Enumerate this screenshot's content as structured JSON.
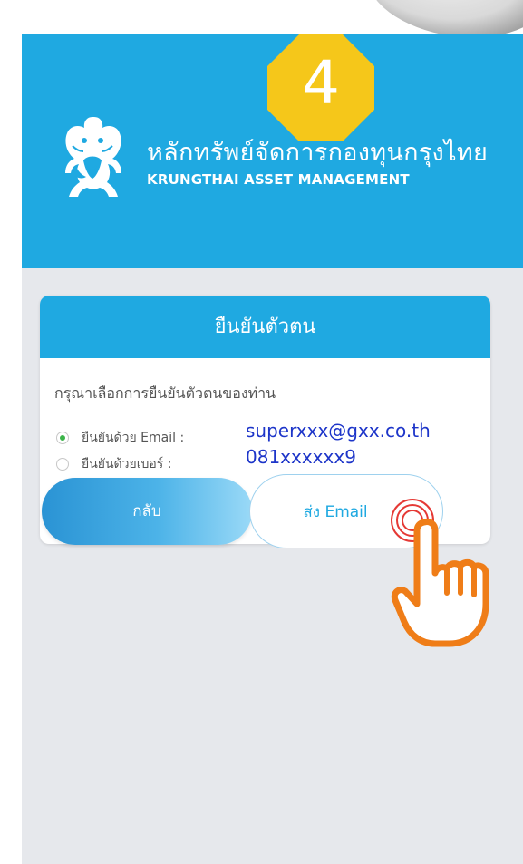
{
  "step": {
    "number": "4"
  },
  "brand": {
    "thai_name": "หลักทรัพย์จัดการกองทุนกรุงไทย",
    "english_name": "KRUNGTHAI ASSET MANAGEMENT"
  },
  "verify": {
    "title": "ยืนยันตัวตน",
    "prompt": "กรุณาเลือกการยืนยันตัวตนของท่าน",
    "options": [
      {
        "label": "ยืนยันด้วย Email :",
        "value": "superxxx@gxx.co.th",
        "selected": true
      },
      {
        "label": "ยืนยันด้วยเบอร์ :",
        "value": "081xxxxxx9",
        "selected": false
      }
    ],
    "buttons": {
      "back_label": "กลับ",
      "send_label": "ส่ง Email"
    }
  },
  "colors": {
    "header_blue": "#1fa9e1",
    "badge_yellow": "#f5c71a",
    "value_blue": "#1d35c9",
    "radio_green": "#3cb44a",
    "hand_orange": "#ef7d18",
    "ripple_red": "#e53935"
  },
  "icons": {
    "logo": "krungthai-garuda-logo",
    "pointer": "tap-hand-icon",
    "ripple": "tap-ripple-icon"
  }
}
